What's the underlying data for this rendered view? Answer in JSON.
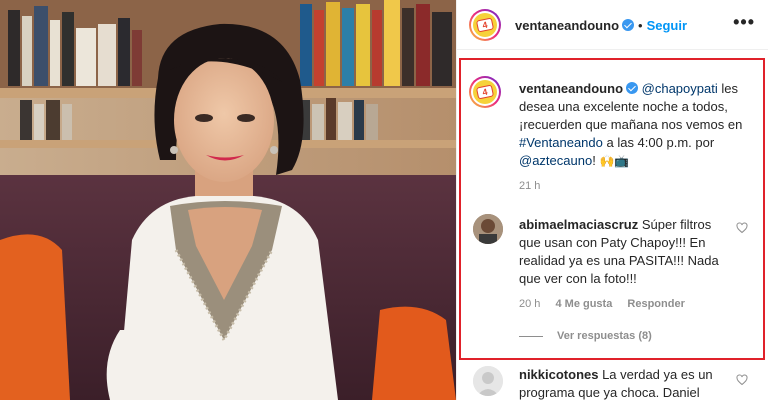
{
  "post": {
    "account": "ventaneandouno",
    "follow_label": "Seguir",
    "separator": "•",
    "more_label": "•••",
    "logo_text": "4"
  },
  "caption": {
    "username": "ventaneandouno",
    "mention_1": "@chapoypati",
    "text_1": " les desea una excelente noche a todos, ¡recuerden que mañana nos vemos en ",
    "hashtag": "#Ventaneando",
    "text_2": " a las 4:00 p.m. por ",
    "mention_2": "@aztecauno",
    "text_3": "! ",
    "emojis": "🙌📺",
    "time": "21 h"
  },
  "comments": [
    {
      "username": "abimaelmaciascruz",
      "text": " Súper filtros que usan con Paty Chapoy!!! En realidad ya es una PASITA!!! Nada que ver con la foto!!!",
      "time": "20 h",
      "likes": "4 Me gusta",
      "reply": "Responder",
      "view_replies": "Ver respuestas (8)"
    },
    {
      "username": "nikkicotones",
      "text": " La verdad ya es un programa que ya choca. Daniel"
    }
  ],
  "colors": {
    "highlight_border": "#e0212a",
    "follow_blue": "#0095f6",
    "mention_blue": "#00376b",
    "verified_blue": "#3897f0"
  }
}
